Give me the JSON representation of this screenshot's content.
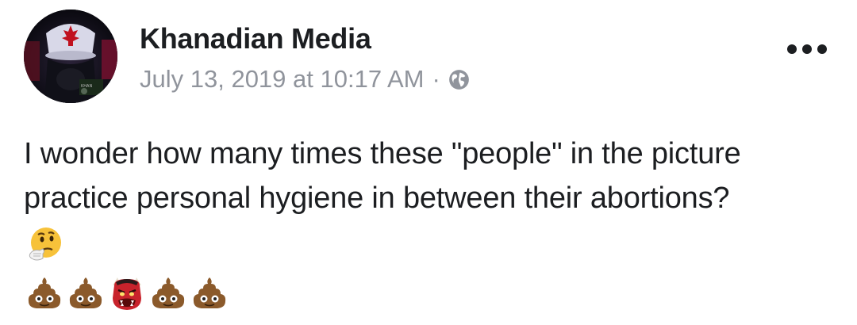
{
  "post": {
    "author": "Khanadian Media",
    "timestamp": "July 13, 2019 at 10:17 AM",
    "separator": "·",
    "privacy_icon": "globe-icon",
    "more_icon": "more-options-icon",
    "text_line_1": "I wonder how many times these \"people\" in the picture",
    "text_line_2": "practice personal hygiene in between their abortions?",
    "emoji_line_1": [
      "thinking-face-emoji"
    ],
    "emoji_line_2": [
      "pile-of-poo-emoji",
      "pile-of-poo-emoji",
      "ogre-emoji",
      "pile-of-poo-emoji",
      "pile-of-poo-emoji"
    ],
    "colors": {
      "name": "#1c1e21",
      "meta": "#90949c",
      "body": "#1c1e21"
    }
  }
}
